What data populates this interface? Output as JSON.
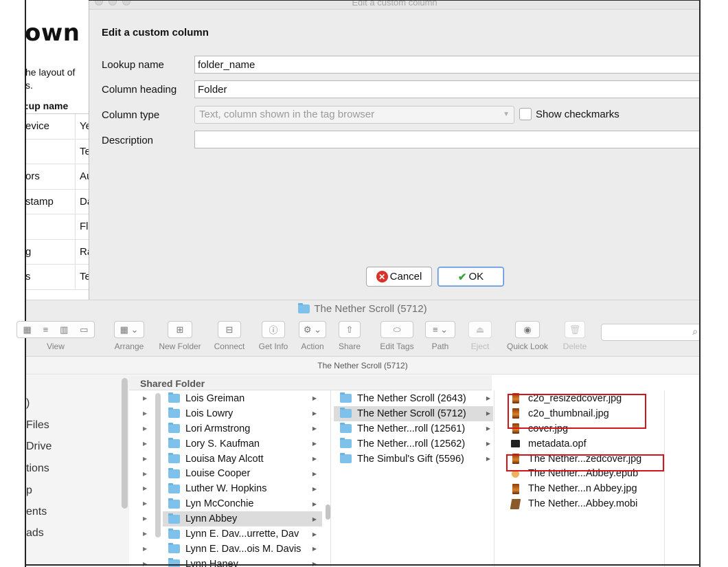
{
  "background": {
    "title": "own c",
    "description_line1": "he layout of",
    "description_line2": "s.",
    "table_header": ":up name",
    "rows": [
      {
        "name": "evice",
        "type": "Ye"
      },
      {
        "name": "",
        "type": "Te"
      },
      {
        "name": "ors",
        "type": "Au"
      },
      {
        "name": "stamp",
        "type": "Da"
      },
      {
        "name": "",
        "type": "Fl"
      },
      {
        "name": "g",
        "type": "Ra"
      },
      {
        "name": "s",
        "type": "Te"
      }
    ]
  },
  "dialog": {
    "window_title": "Edit a custom column",
    "heading": "Edit a custom column",
    "lookup_label": "Lookup name",
    "lookup_value": "folder_name",
    "heading_label": "Column heading",
    "heading_value": "Folder",
    "type_label": "Column type",
    "type_value": "Text, column shown in the tag browser",
    "show_checkmarks_label": "Show checkmarks",
    "description_label": "Description",
    "description_value": "",
    "cancel_label": "Cancel",
    "ok_label": "OK"
  },
  "finder": {
    "window_title": "The Nether Scroll (5712)",
    "path_title": "The Nether Scroll (5712)",
    "toolbar": {
      "view": "View",
      "arrange": "Arrange",
      "new_folder": "New Folder",
      "connect": "Connect",
      "get_info": "Get Info",
      "action": "Action",
      "share": "Share",
      "edit_tags": "Edit Tags",
      "path": "Path",
      "eject": "Eject",
      "quick_look": "Quick Look",
      "delete": "Delete"
    },
    "sidebar_items": [
      ")",
      "Files",
      "Drive",
      "tions",
      "p",
      "ents",
      "ads"
    ],
    "column1_header": "Shared Folder",
    "column1": [
      {
        "name": "Lois Greiman"
      },
      {
        "name": "Lois Lowry"
      },
      {
        "name": "Lori Armstrong"
      },
      {
        "name": "Lory S. Kaufman"
      },
      {
        "name": "Louisa May Alcott"
      },
      {
        "name": "Louise Cooper"
      },
      {
        "name": "Luther W. Hopkins"
      },
      {
        "name": "Lyn McConchie"
      },
      {
        "name": "Lynn Abbey",
        "selected": true
      },
      {
        "name": "Lynn E. Dav...urrette, Dav"
      },
      {
        "name": "Lynn E. Dav...ois M. Davis"
      },
      {
        "name": "Lynn Haney"
      }
    ],
    "column2": [
      {
        "name": "The Nether Scroll (2643)"
      },
      {
        "name": "The Nether Scroll (5712)",
        "selected": true
      },
      {
        "name": "The Nether...roll (12561)"
      },
      {
        "name": "The Nether...roll (12562)"
      },
      {
        "name": "The Simbul's Gift (5596)"
      }
    ],
    "column3": [
      {
        "name": "c2o_resizedcover.jpg",
        "kind": "jpg"
      },
      {
        "name": "c2o_thumbnail.jpg",
        "kind": "jpg"
      },
      {
        "name": "cover.jpg",
        "kind": "jpg"
      },
      {
        "name": "metadata.opf",
        "kind": "opf"
      },
      {
        "name": "The Nether...zedcover.jpg",
        "kind": "jpg"
      },
      {
        "name": "The Nether...Abbey.epub",
        "kind": "epub"
      },
      {
        "name": "The Nether...n Abbey.jpg",
        "kind": "jpg"
      },
      {
        "name": "The Nether...Abbey.mobi",
        "kind": "mobi"
      }
    ]
  },
  "colors": {
    "highlight": "#d0151b",
    "folder": "#7ec2ec",
    "selection": "#dcdcdc",
    "ok_focus": "#5a8fd6",
    "cancel_icon": "#d8322a"
  }
}
